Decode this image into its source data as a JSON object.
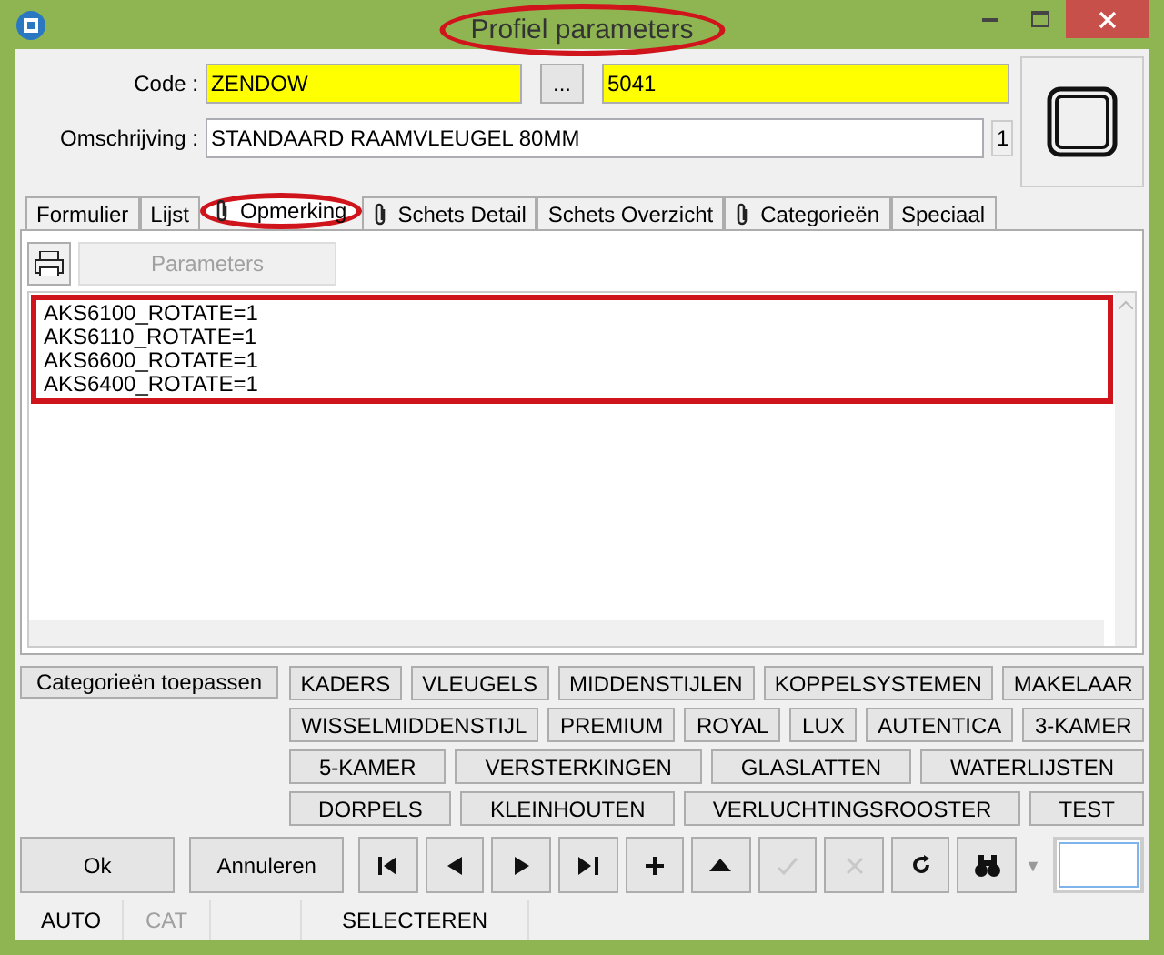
{
  "window": {
    "title": "Profiel parameters",
    "title_highlighted": true
  },
  "header": {
    "code_label": "Code :",
    "code_value": "ZENDOW",
    "browse_button": "...",
    "number_value": "5041",
    "description_label": "Omschrijving :",
    "description_value": "STANDAARD RAAMVLEUGEL 80MM",
    "counter": "1"
  },
  "tabs": [
    {
      "label": "Formulier",
      "clip": false,
      "selected": false,
      "highlighted": false
    },
    {
      "label": "Lijst",
      "clip": false,
      "selected": false,
      "highlighted": false
    },
    {
      "label": "Opmerking",
      "clip": true,
      "selected": true,
      "highlighted": true
    },
    {
      "label": "Schets Detail",
      "clip": true,
      "selected": false,
      "highlighted": false
    },
    {
      "label": "Schets Overzicht",
      "clip": false,
      "selected": false,
      "highlighted": false
    },
    {
      "label": "Categorieën",
      "clip": true,
      "selected": false,
      "highlighted": false
    },
    {
      "label": "Speciaal",
      "clip": false,
      "selected": false,
      "highlighted": false
    }
  ],
  "toolbar": {
    "parameters_button": {
      "label": "Parameters",
      "disabled": true
    }
  },
  "memo": {
    "highlighted": true,
    "lines": [
      "AKS6100_ROTATE=1",
      "AKS6110_ROTATE=1",
      "AKS6600_ROTATE=1",
      "AKS6400_ROTATE=1"
    ]
  },
  "categories": {
    "apply_button": "Categorieën toepassen",
    "groups": [
      {
        "buttons": [
          "KADERS",
          "VLEUGELS",
          "MIDDENSTIJLEN",
          "KOPPELSYSTEMEN",
          "MAKELAAR"
        ]
      },
      {
        "buttons": [
          "WISSELMIDDENSTIJL",
          "PREMIUM",
          "ROYAL",
          "LUX",
          "AUTENTICA",
          "3-KAMER"
        ]
      },
      {
        "buttons": [
          "5-KAMER",
          "VERSTERKINGEN",
          "GLASLATTEN",
          "WATERLIJSTEN"
        ]
      },
      {
        "buttons": [
          "DORPELS",
          "KLEINHOUTEN",
          "VERLUCHTINGSROOSTER",
          "TEST"
        ]
      }
    ]
  },
  "dropdown_arrow": "▼",
  "buttons": [
    {
      "label": "Ok"
    },
    {
      "label": "Annuleren"
    }
  ],
  "nav_buttons": [
    {
      "kind": "first",
      "disabled": false
    },
    {
      "kind": "prev",
      "disabled": false
    },
    {
      "kind": "next",
      "disabled": false
    },
    {
      "kind": "last",
      "disabled": false
    },
    {
      "kind": "add",
      "disabled": false
    },
    {
      "kind": "up",
      "disabled": false
    },
    {
      "kind": "confirm",
      "disabled": true
    },
    {
      "kind": "cancel",
      "disabled": true
    },
    {
      "kind": "refresh",
      "disabled": false
    },
    {
      "kind": "find",
      "disabled": false
    }
  ],
  "status_bar": [
    {
      "text": "AUTO",
      "disabled": false
    },
    {
      "text": "CAT",
      "disabled": true
    },
    {
      "text": "SELECTEREN",
      "disabled": false
    }
  ]
}
